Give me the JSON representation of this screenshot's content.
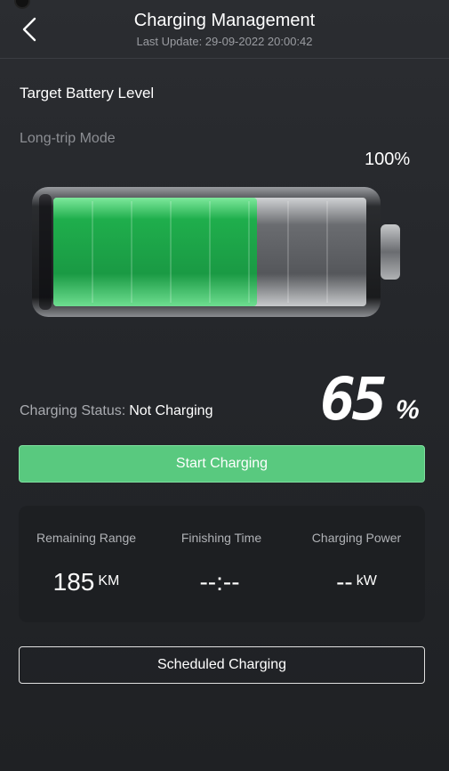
{
  "header": {
    "title": "Charging Management",
    "last_update": "Last Update: 29-09-2022 20:00:42"
  },
  "target": {
    "section_title": "Target Battery Level",
    "mode_label": "Long-trip Mode",
    "target_percent_label": "100%",
    "target_level": 1.0
  },
  "battery": {
    "current_level": 0.65,
    "fill_color": "#1fae4c",
    "empty_color": "#6a6c70"
  },
  "status": {
    "label": "Charging Status:",
    "value": "Not Charging",
    "level_number": "65",
    "level_unit": "%"
  },
  "actions": {
    "start_label": "Start Charging",
    "scheduled_label": "Scheduled Charging",
    "accent_color": "#59c97f"
  },
  "stats": [
    {
      "label": "Remaining Range",
      "value": "185",
      "unit": "KM"
    },
    {
      "label": "Finishing Time",
      "value": "--:--",
      "unit": ""
    },
    {
      "label": "Charging Power",
      "value": "--",
      "unit": "kW"
    }
  ]
}
